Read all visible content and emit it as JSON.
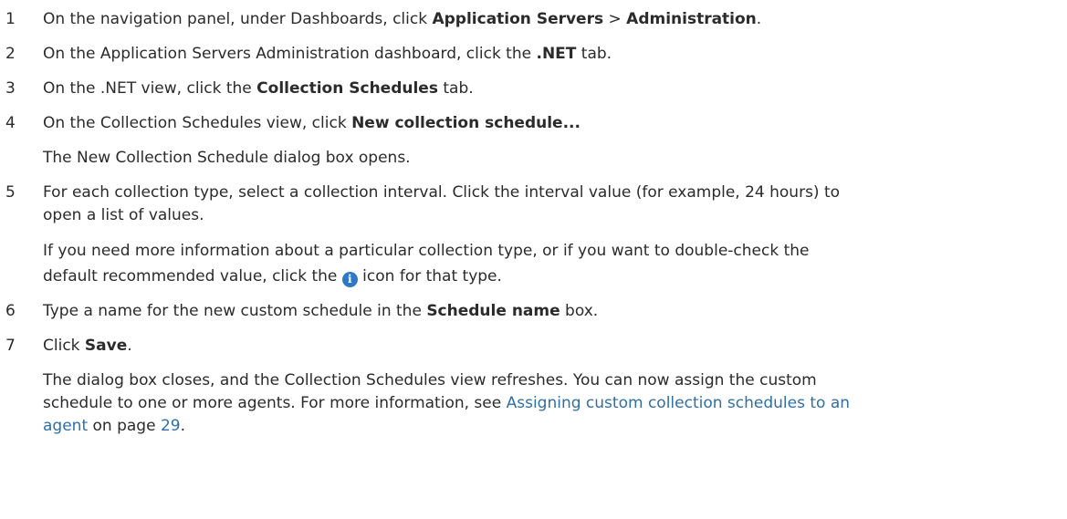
{
  "steps": [
    {
      "num": "1",
      "t0": "On the navigation panel, under Dashboards, click ",
      "b0": "Application Servers",
      "t1": " > ",
      "b1": "Administration",
      "t2": "."
    },
    {
      "num": "2",
      "t0": "On the Application Servers Administration dashboard, click the ",
      "b0": ".NET",
      "t1": " tab."
    },
    {
      "num": "3",
      "t0": "On the .NET view, click the ",
      "b0": "Collection Schedules",
      "t1": " tab."
    },
    {
      "num": "4",
      "t0": "On the Collection Schedules view, click ",
      "b0": "New collection schedule...",
      "note": "The New Collection Schedule dialog box opens."
    },
    {
      "num": "5",
      "line1": "For each collection type, select a collection interval. Click the interval value (for example, 24 hours) to",
      "line2": "open a list of values.",
      "note1": "If you need more information about a particular collection type, or if you want to double-check the",
      "note2a": "default recommended value, click the ",
      "icon_glyph": "i",
      "note2b": " icon for that type."
    },
    {
      "num": "6",
      "t0": "Type a name for the new custom schedule in the ",
      "b0": "Schedule name",
      "t1": " box."
    },
    {
      "num": "7",
      "t0": "Click ",
      "b0": "Save",
      "t1": ".",
      "note1": "The dialog box closes, and the Collection Schedules view refreshes. You can now assign the custom",
      "note2a": "schedule to one or more agents. For more information, see ",
      "link1": "Assigning custom collection schedules to an",
      "link2": "agent",
      "note3a": " on page ",
      "page": "29",
      "note3b": "."
    }
  ],
  "colors": {
    "text": "#2b2b2b",
    "link": "#2f6fa8",
    "icon": "#2d79c7"
  }
}
